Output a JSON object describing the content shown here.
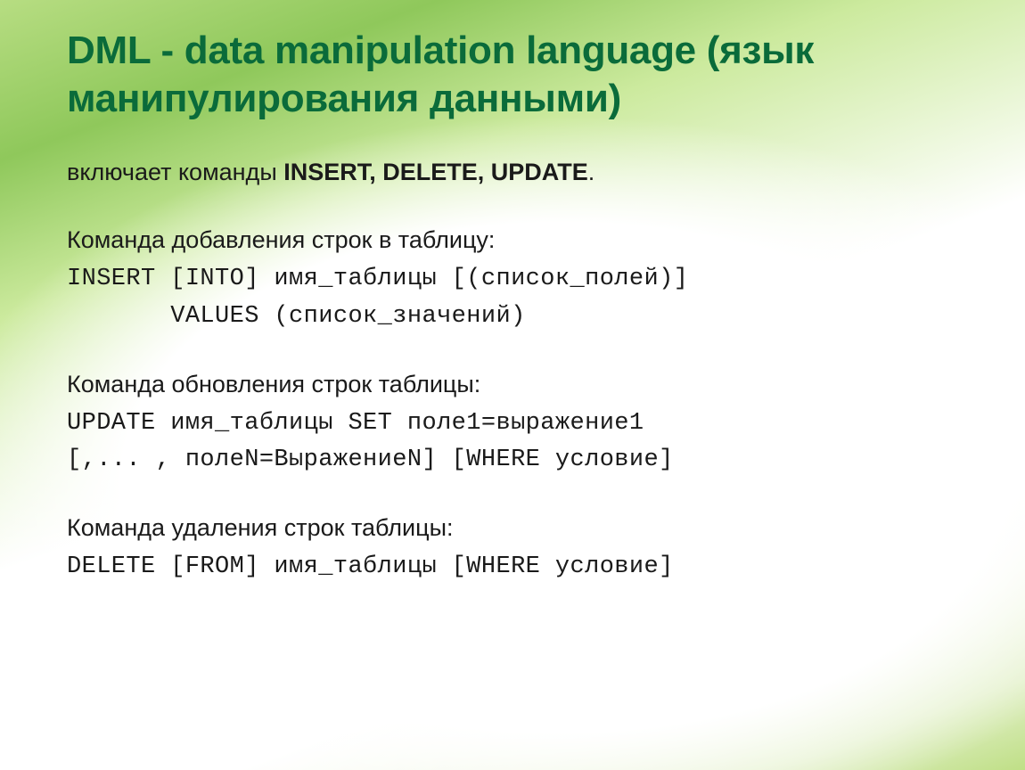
{
  "title": "DML - data manipulation language (язык манипулирования данными)",
  "intro_prefix": "включает команды ",
  "intro_commands": "INSERT, DELETE, UPDATE",
  "intro_suffix": ".",
  "insert_label": "Команда добавления строк в таблицу:",
  "insert_code": "INSERT [INTO] имя_таблицы [(список_полей)]\n       VALUES (список_значений)",
  "update_label": "Команда обновления строк таблицы:",
  "update_code": "UPDATE имя_таблицы SET поле1=выражение1\n[,... , полеN=ВыражениеN] [WHERE условие]",
  "delete_label": "Команда удаления строк таблицы:",
  "delete_code": "DELETE [FROM] имя_таблицы [WHERE условие]"
}
